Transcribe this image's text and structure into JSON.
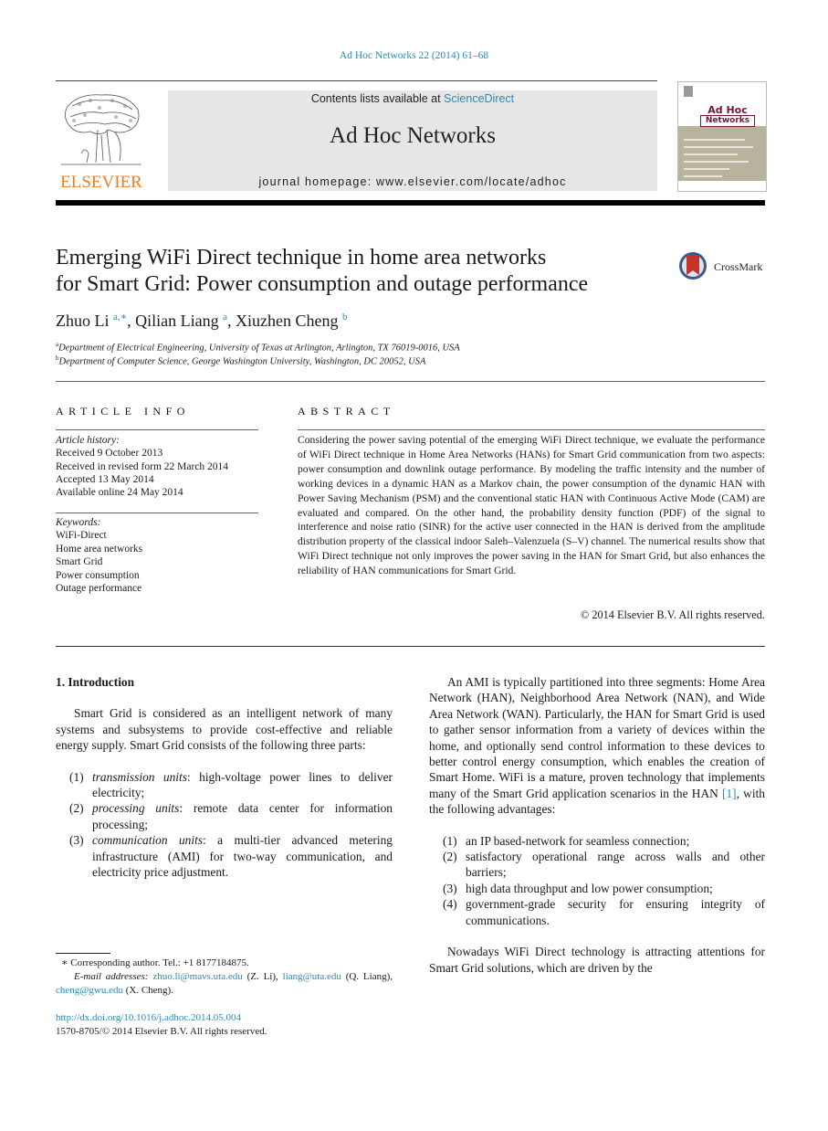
{
  "citation": "Ad Hoc Networks 22 (2014) 61–68",
  "header": {
    "publisher_wordmark": "ELSEVIER",
    "contents_prefix": "Contents lists available at ",
    "contents_link": "ScienceDirect",
    "journal_name": "Ad Hoc Networks",
    "homepage": "journal homepage: www.elsevier.com/locate/adhoc",
    "cover_title_line1": "Ad Hoc",
    "cover_title_line2": "Networks"
  },
  "article": {
    "title_line1": "Emerging WiFi Direct technique in home area networks",
    "title_line2": "for Smart Grid: Power consumption and outage performance",
    "crossmark_label": "CrossMark",
    "authors": [
      {
        "name": "Zhuo Li",
        "sup": "a,∗"
      },
      {
        "name": "Qilian Liang",
        "sup": "a"
      },
      {
        "name": "Xiuzhen Cheng",
        "sup": "b"
      }
    ],
    "affiliations": [
      {
        "key": "a",
        "text": "Department of Electrical Engineering, University of Texas at Arlington, Arlington, TX 76019-0016, USA"
      },
      {
        "key": "b",
        "text": "Department of Computer Science, George Washington University, Washington, DC 20052, USA"
      }
    ]
  },
  "article_info": {
    "heading": "ARTICLE INFO",
    "history_label": "Article history:",
    "history": [
      "Received 9 October 2013",
      "Received in revised form 22 March 2014",
      "Accepted 13 May 2014",
      "Available online 24 May 2014"
    ],
    "keywords_label": "Keywords:",
    "keywords": [
      "WiFi-Direct",
      "Home area networks",
      "Smart Grid",
      "Power consumption",
      "Outage performance"
    ]
  },
  "abstract": {
    "heading": "ABSTRACT",
    "text": "Considering the power saving potential of the emerging WiFi Direct technique, we evaluate the performance of WiFi Direct technique in Home Area Networks (HANs) for Smart Grid communication from two aspects: power consumption and downlink outage performance. By modeling the traffic intensity and the number of working devices in a dynamic HAN as a Markov chain, the power consumption of the dynamic HAN with Power Saving Mechanism (PSM) and the conventional static HAN with Continuous Active Mode (CAM) are evaluated and compared. On the other hand, the probability density function (PDF) of the signal to interference and noise ratio (SINR) for the active user connected in the HAN is derived from the amplitude distribution property of the classical indoor Saleh–Valenzuela (S–V) channel. The numerical results show that WiFi Direct technique not only improves the power saving in the HAN for Smart Grid, but also enhances the reliability of HAN communications for Smart Grid.",
    "copyright": "© 2014 Elsevier B.V. All rights reserved."
  },
  "body": {
    "section_heading": "1. Introduction",
    "left_para1": "Smart Grid is considered as an intelligent network of many systems and subsystems to provide cost-effective and reliable energy supply. Smart Grid consists of the following three parts:",
    "left_list": [
      {
        "num": "(1)",
        "term": "transmission units",
        "text": ": high-voltage power lines to deliver electricity;"
      },
      {
        "num": "(2)",
        "term": "processing units",
        "text": ": remote data center for information processing;"
      },
      {
        "num": "(3)",
        "term": "communication units",
        "text": ": a multi-tier advanced metering infrastructure (AMI) for two-way communication, and electricity price adjustment."
      }
    ],
    "right_para1_before_ref": "An AMI is typically partitioned into three segments: Home Area Network (HAN), Neighborhood Area Network (NAN), and Wide Area Network (WAN). Particularly, the HAN for Smart Grid is used to gather sensor information from a variety of devices within the home, and optionally send control information to these devices to better control energy consumption, which enables the creation of Smart Home. WiFi is a mature, proven technology that implements many of the Smart Grid application scenarios in the HAN ",
    "right_para1_ref": "[1]",
    "right_para1_after_ref": ", with the following advantages:",
    "right_list": [
      {
        "num": "(1)",
        "text": "an IP based-network for seamless connection;"
      },
      {
        "num": "(2)",
        "text": "satisfactory operational range across walls and other barriers;"
      },
      {
        "num": "(3)",
        "text": "high data throughput and low power consumption;"
      },
      {
        "num": "(4)",
        "text": "government-grade security for ensuring integrity of communications."
      }
    ],
    "right_para2": "Nowadays WiFi Direct technology is attracting attentions for Smart Grid solutions, which are driven by the"
  },
  "footnotes": {
    "corresponding": "∗ Corresponding author. Tel.: +1 8177184875.",
    "email_label": "E-mail addresses:",
    "emails": [
      {
        "address": "zhuo.li@mavs.uta.edu",
        "owner": " (Z. Li), "
      },
      {
        "address": "liang@uta.edu",
        "owner": " (Q. Liang), "
      },
      {
        "address": "cheng@gwu.edu",
        "owner": " (X. Cheng)."
      }
    ],
    "doi": "http://dx.doi.org/10.1016/j.adhoc.2014.05.004",
    "issn_copyright": "1570-8705/© 2014 Elsevier B.V. All rights reserved."
  },
  "colors": {
    "link": "#2a8ab8",
    "elsevier_orange": "#f07c1e",
    "banner_gray": "#e6e6e6",
    "cover_maroon": "#7a1436"
  }
}
